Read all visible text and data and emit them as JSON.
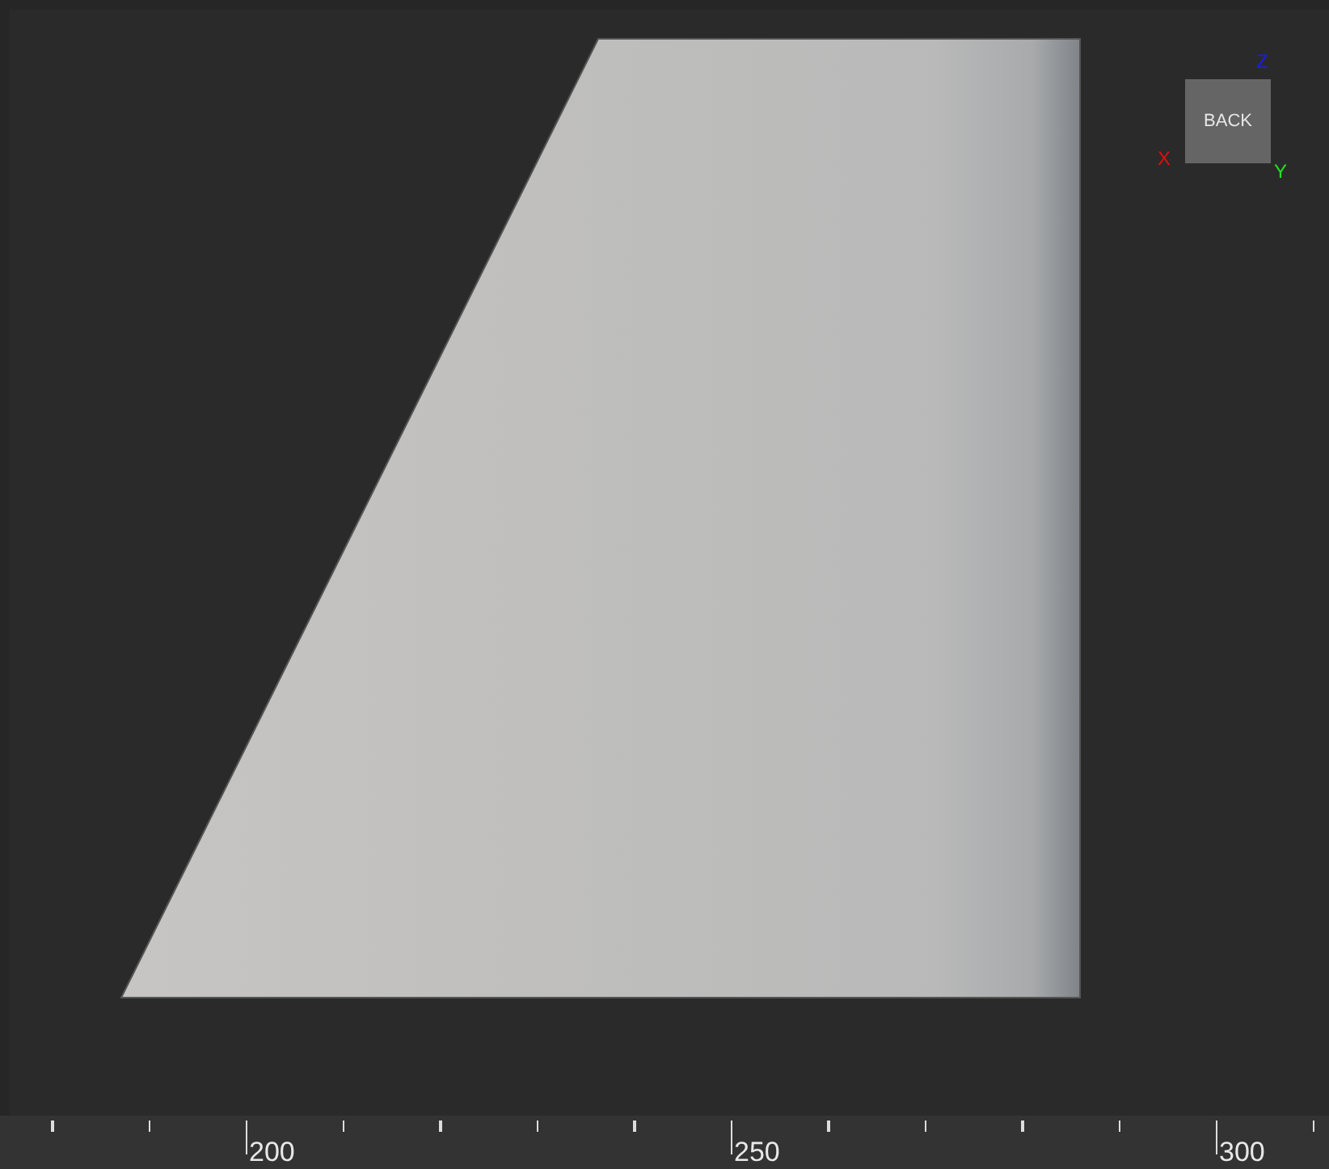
{
  "view_cube": {
    "face": "BACK",
    "axes": [
      {
        "kind": "z",
        "label": "Z",
        "color": "#1a1aff"
      },
      {
        "kind": "x",
        "label": "X",
        "color": "#e01010"
      },
      {
        "kind": "y",
        "label": "Y",
        "color": "#20e020"
      }
    ]
  },
  "ruler": {
    "labels": [
      "200",
      "250",
      "300"
    ]
  }
}
